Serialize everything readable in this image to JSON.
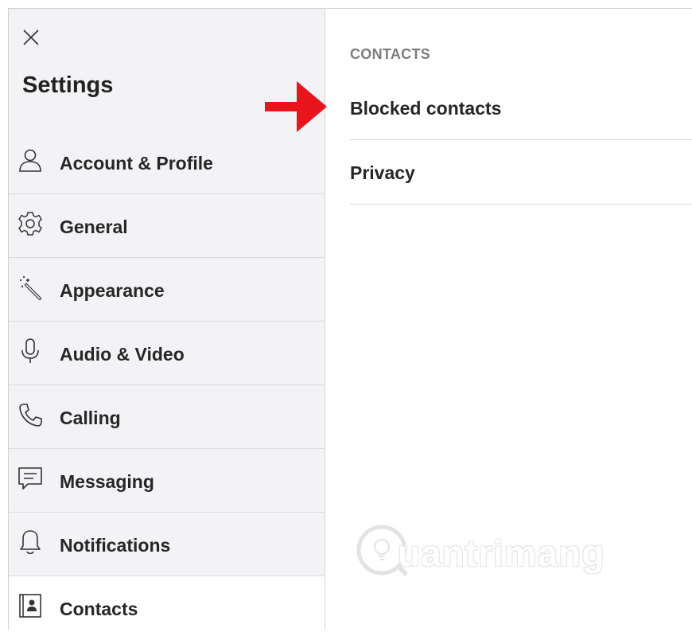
{
  "sidebar": {
    "title": "Settings",
    "items": [
      {
        "label": "Account & Profile",
        "icon": "person-icon"
      },
      {
        "label": "General",
        "icon": "gear-icon"
      },
      {
        "label": "Appearance",
        "icon": "magic-wand-icon"
      },
      {
        "label": "Audio & Video",
        "icon": "microphone-icon"
      },
      {
        "label": "Calling",
        "icon": "phone-icon"
      },
      {
        "label": "Messaging",
        "icon": "message-icon"
      },
      {
        "label": "Notifications",
        "icon": "bell-icon"
      },
      {
        "label": "Contacts",
        "icon": "contact-card-icon"
      }
    ],
    "active_item": "Contacts"
  },
  "content": {
    "section_header": "CONTACTS",
    "rows": [
      {
        "label": "Blocked contacts"
      },
      {
        "label": "Privacy"
      }
    ]
  },
  "annotation": {
    "arrow_color": "#e8141c"
  },
  "watermark": {
    "text": "uantrimang"
  }
}
